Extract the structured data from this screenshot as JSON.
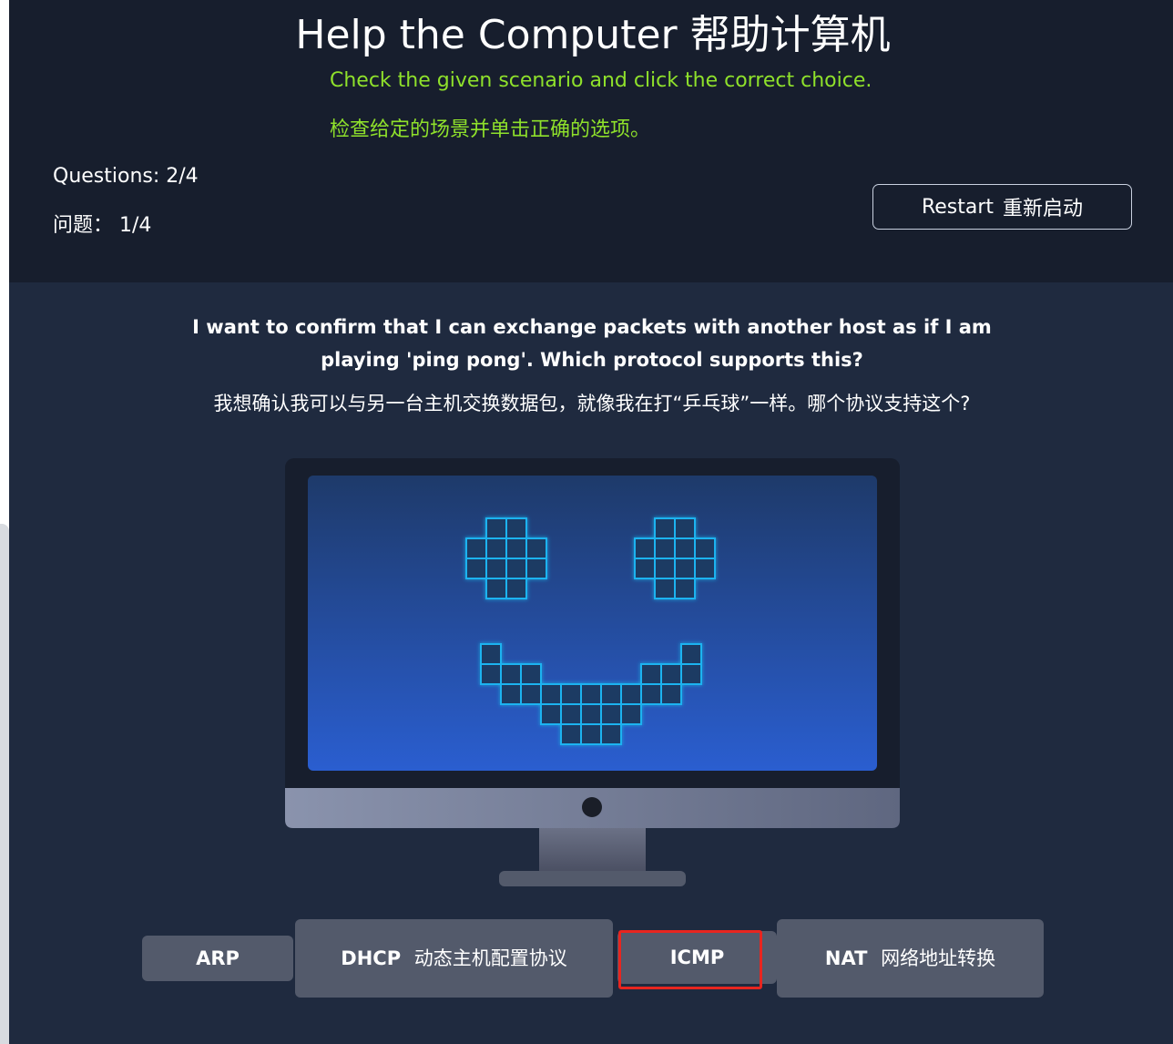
{
  "header": {
    "title_en": "Help the Computer",
    "title_zh": "帮助计算机",
    "instruction_en": "Check the given scenario and click the correct choice.",
    "instruction_zh": "检查给定的场景并单击正确的选项。",
    "questions_en": "Questions: 2/4",
    "questions_zh": "问题：  1/4",
    "restart_en": "Restart",
    "restart_zh": "重新启动"
  },
  "question": {
    "text_en": "I want to confirm that I can exchange packets with another host as if I am playing 'ping pong'. Which protocol supports this?",
    "text_zh": "我想确认我可以与另一台主机交换数据包，就像我在打“乒乓球”一样。哪个协议支持这个?"
  },
  "choices": [
    {
      "label": "ARP",
      "label_zh": ""
    },
    {
      "label": "DHCP",
      "label_zh": "动态主机配置协议"
    },
    {
      "label": "ICMP",
      "label_zh": ""
    },
    {
      "label": "NAT",
      "label_zh": "网络地址转换"
    }
  ],
  "selected_choice": "ICMP",
  "colors": {
    "header_bg": "#171e2d",
    "body_bg": "#1f2a3f",
    "instruction": "#8fe12b",
    "choice_bg": "#535a6b",
    "highlight": "#e8251f",
    "pixel_glow": "#1ab3f0"
  },
  "monitor_icon": "smiley-face-monitor-icon"
}
